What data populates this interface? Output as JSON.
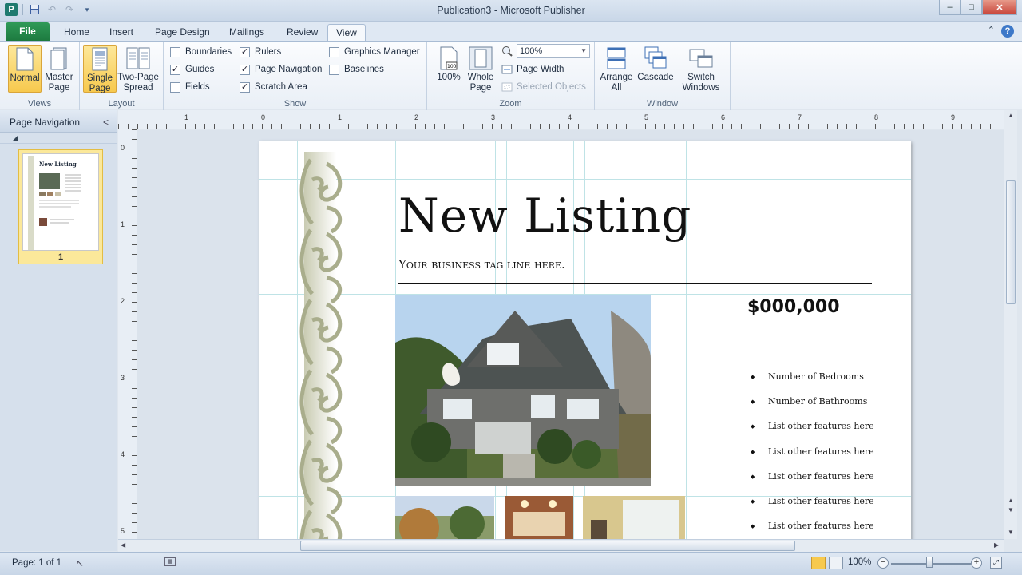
{
  "window": {
    "title": "Publication3  -  Microsoft Publisher",
    "app_icon_letter": "P",
    "minimize": "–",
    "maximize": "□",
    "close": "✕"
  },
  "tabs": [
    {
      "label": "File"
    },
    {
      "label": "Home"
    },
    {
      "label": "Insert"
    },
    {
      "label": "Page Design"
    },
    {
      "label": "Mailings"
    },
    {
      "label": "Review"
    },
    {
      "label": "View"
    }
  ],
  "active_tab": "View",
  "ribbon": {
    "views": {
      "label": "Views",
      "normal": "Normal",
      "master_page": "Master Page"
    },
    "layout": {
      "label": "Layout",
      "single_page": "Single Page",
      "two_page_spread": "Two-Page Spread"
    },
    "show": {
      "label": "Show",
      "boundaries": {
        "label": "Boundaries",
        "checked": false
      },
      "guides": {
        "label": "Guides",
        "checked": true
      },
      "fields": {
        "label": "Fields",
        "checked": false
      },
      "rulers": {
        "label": "Rulers",
        "checked": true
      },
      "page_navigation": {
        "label": "Page Navigation",
        "checked": true
      },
      "scratch_area": {
        "label": "Scratch Area",
        "checked": true
      },
      "graphics_manager": {
        "label": "Graphics Manager",
        "checked": false
      },
      "baselines": {
        "label": "Baselines",
        "checked": false
      }
    },
    "zoom": {
      "label": "Zoom",
      "hundred": "100%",
      "whole_page": "Whole Page",
      "zoom_value": "100%",
      "page_width": "Page Width",
      "selected_objects": "Selected Objects"
    },
    "window": {
      "label": "Window",
      "arrange_all": "Arrange All",
      "cascade": "Cascade",
      "switch_windows": "Switch Windows"
    }
  },
  "nav_pane": {
    "title": "Page Navigation",
    "page_number": "1",
    "thumb_title": "New Listing"
  },
  "rulers": {
    "horizontal": [
      "1",
      "0",
      "1",
      "2",
      "3",
      "4",
      "5",
      "6",
      "7",
      "8",
      "9"
    ],
    "vertical": [
      "0",
      "1",
      "2",
      "3",
      "4",
      "5"
    ]
  },
  "document": {
    "headline": "New Listing",
    "tagline": "Your business tag line here.",
    "price": "$000,000",
    "features": [
      "Number of Bedrooms",
      "Number of Bathrooms",
      "List other features here",
      "List other features here",
      "List other features here",
      "List other features here",
      "List other features here"
    ]
  },
  "status": {
    "page": "Page: 1 of 1",
    "zoom": "100%"
  },
  "colors": {
    "file_tab": "#1d7a3f",
    "selected_button": "#f7c94e",
    "guide": "#bfe3e6",
    "scroll_ornament": "#a9ad8c"
  }
}
